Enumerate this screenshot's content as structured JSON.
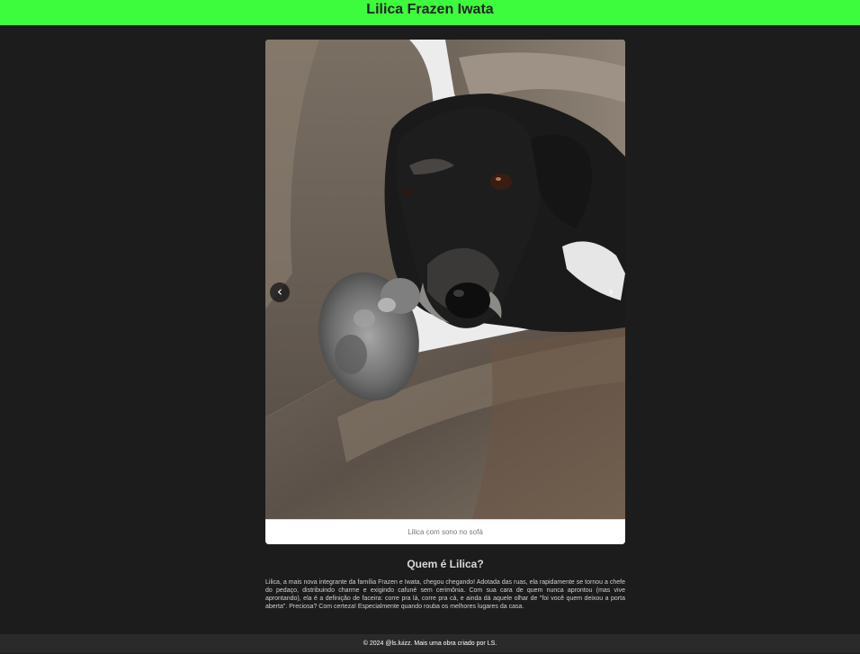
{
  "header": {
    "title": "Lilica Frazen Iwata"
  },
  "carousel": {
    "image_alt": "Lilica com sono no sofá",
    "caption": "Lilica com sono no sofá",
    "prev_icon": "‹",
    "next_icon": "›"
  },
  "about": {
    "title": "Quem é Lilica?",
    "text": "Lilica, a mais nova integrante da família Frazen e Iwata, chegou chegando! Adotada das ruas, ela rapidamente se tornou a chefe do pedaço, distribuindo charme e exigindo cafuné sem cerimônia. Com sua cara de quem nunca aprontou (mas vive aprontando), ela é a definição de faceira: corre pra lá, corre pra cá, e ainda dá aquele olhar de \"foi você quem deixou a porta aberta\". Preciosa? Com certeza! Especialmente quando rouba os melhores lugares da casa."
  },
  "footer": {
    "text": "© 2024 @ls.luizz. Mais uma obra criado por LS."
  },
  "colors": {
    "header_bg": "#3dfc3d",
    "page_bg": "#1c1c1c",
    "footer_bg": "#2a2a2a"
  }
}
